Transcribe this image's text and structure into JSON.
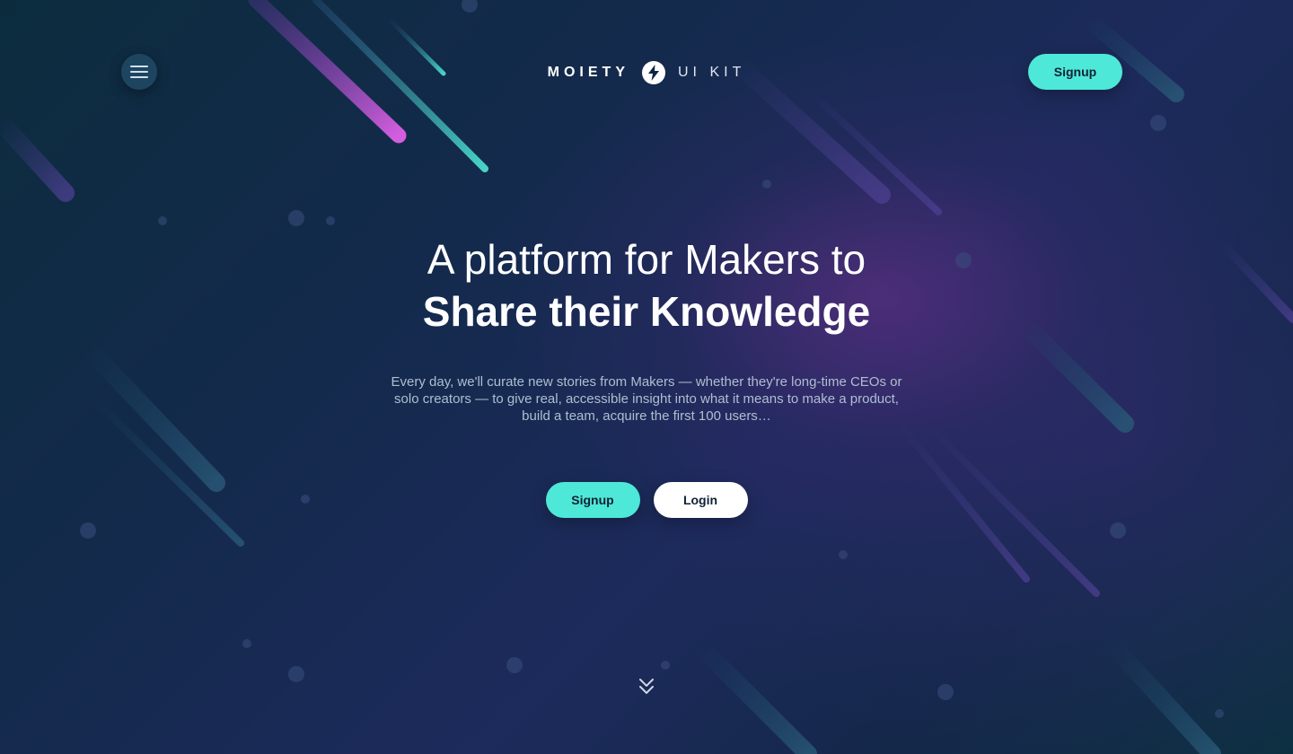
{
  "brand": {
    "name": "MOIETY",
    "sub": "UI KIT",
    "logo_icon": "lightning-bolt-icon"
  },
  "header": {
    "menu_icon": "hamburger-menu-icon",
    "signup_label": "Signup"
  },
  "hero": {
    "title_line1": "A platform for Makers to",
    "title_line2": "Share their Knowledge",
    "description": "Every day, we'll curate new stories from Makers — whether they're long-time CEOs or solo creators — to give real, accessible insight into what it means to make a product, build a team, acquire the first 100 users…",
    "signup_label": "Signup",
    "login_label": "Login",
    "scroll_icon": "chevron-double-down-icon"
  },
  "colors": {
    "accent": "#4ee8d8",
    "background": "#0f2540",
    "purple_glow": "#70308c",
    "magenta_streak": "#d05cdc"
  }
}
